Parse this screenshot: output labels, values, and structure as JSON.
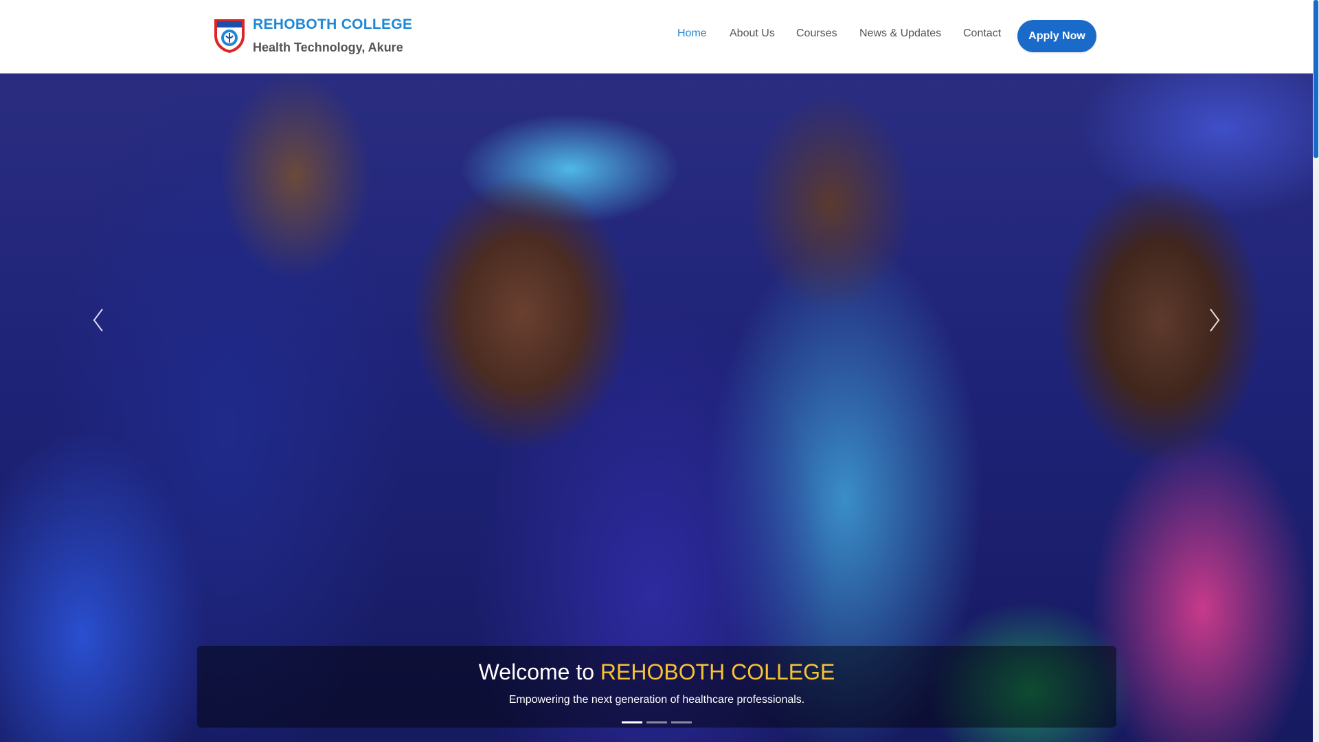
{
  "header": {
    "brand_name": "REHOBOTH COLLEGE",
    "brand_subtitle": "Health Technology, Akure",
    "logo_icon": "college-crest-icon",
    "nav": [
      {
        "label": "Home",
        "active": true
      },
      {
        "label": "About Us",
        "active": false
      },
      {
        "label": "Courses",
        "active": false
      },
      {
        "label": "News & Updates",
        "active": false
      },
      {
        "label": "Contact",
        "active": false
      }
    ],
    "apply_label": "Apply Now"
  },
  "hero": {
    "caption_prefix": "Welcome to ",
    "caption_highlight": "REHOBOTH COLLEGE",
    "caption_subtitle": "Empowering the next generation of healthcare professionals.",
    "slide_count": 3,
    "active_slide": 1,
    "prev_icon": "chevron-left-icon",
    "next_icon": "chevron-right-icon"
  },
  "colors": {
    "brand_blue": "#1e88d6",
    "button_blue": "#1a6bc9",
    "highlight_gold": "#f7c331",
    "nav_text": "#555555"
  }
}
